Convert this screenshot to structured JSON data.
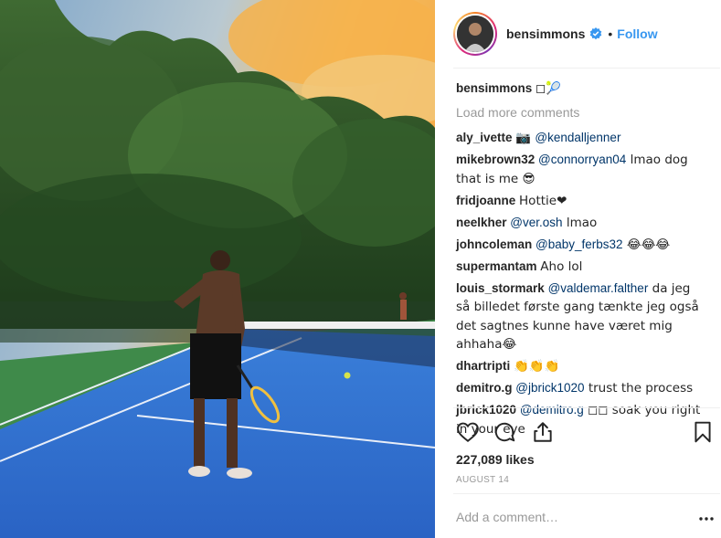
{
  "post": {
    "author": "bensimmons",
    "follow_label": "Follow",
    "separator": "•",
    "caption_user": "bensimmons",
    "caption_text": "◻🎾",
    "load_more": "Load more comments",
    "likes": "227,089 likes",
    "date": "AUGUST 14",
    "add_comment_placeholder": "Add a comment…"
  },
  "comments": [
    {
      "user": "aly_ivette",
      "pre": "📷 ",
      "mention": "@kendalljenner",
      "post": ""
    },
    {
      "user": "mikebrown32",
      "pre": "",
      "mention": "@connorryan04",
      "post": " lmao dog that is me 😎"
    },
    {
      "user": "fridjoanne",
      "pre": "Hottie❤",
      "mention": "",
      "post": ""
    },
    {
      "user": "neelkher",
      "pre": "",
      "mention": "@ver.osh",
      "post": " lmao"
    },
    {
      "user": "johncoleman",
      "pre": "",
      "mention": "@baby_ferbs32",
      "post": " 😂😂😂"
    },
    {
      "user": "supermantam",
      "pre": "Aho lol",
      "mention": "",
      "post": ""
    },
    {
      "user": "louis_stormark",
      "pre": "",
      "mention": "@valdemar.falther",
      "post": " da jeg så billedet første gang tænkte jeg også det sagtnes kunne have været mig ahhaha😂"
    },
    {
      "user": "dhartripti",
      "pre": "👏👏👏",
      "mention": "",
      "post": ""
    },
    {
      "user": "demitro.g",
      "pre": "",
      "mention": "@jbrick1020",
      "post": " trust the process"
    },
    {
      "user": "jbrick1020",
      "pre": "",
      "mention": "@demitro.g",
      "post": " ◻◻ soak you right in your eye"
    }
  ],
  "icons": {
    "verified": "verified-badge-icon",
    "like": "heart-icon",
    "comment": "comment-bubble-icon",
    "share": "share-icon",
    "save": "bookmark-icon",
    "more": "more-options-icon"
  },
  "colors": {
    "link": "#3897f0",
    "mention": "#003569",
    "muted": "#999999",
    "court": "#2f6fd1",
    "court_surround": "#3f8a4a"
  }
}
